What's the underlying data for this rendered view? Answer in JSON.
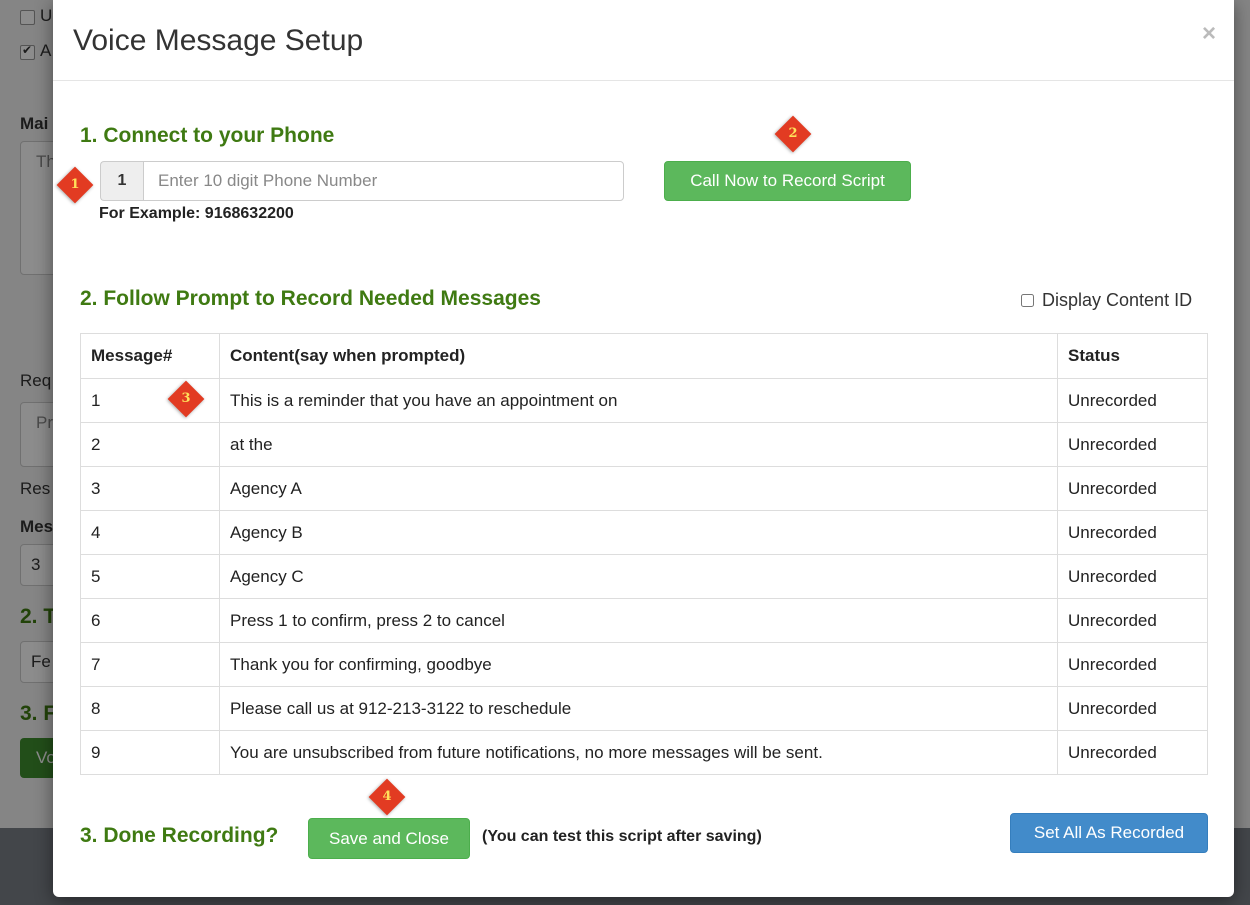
{
  "background": {
    "check1_label": "U",
    "check2_label": "A",
    "label_main": "Mai",
    "label_main_box": "Th",
    "label_req": "Req",
    "label_req_box": "Pr",
    "label_res": "Res",
    "label_mes": "Mes",
    "label_mes_value": "3",
    "section2": "2. T",
    "select_value": "Fe",
    "section3": "3. F",
    "button_label": "Vo"
  },
  "modal": {
    "title": "Voice Message Setup",
    "close_glyph": "×"
  },
  "markers": [
    "1",
    "2",
    "3",
    "4"
  ],
  "step1": {
    "title": "1. Connect to your Phone",
    "country_code": "1",
    "phone_placeholder": "Enter 10 digit Phone Number",
    "phone_value": "",
    "example": "For Example: 9168632200",
    "call_button": "Call Now to Record Script"
  },
  "step2": {
    "title": "2. Follow Prompt to Record Needed Messages",
    "display_content_id_label": "Display Content ID",
    "display_content_id_checked": false,
    "columns": [
      "Message#",
      "Content(say when prompted)",
      "Status"
    ],
    "rows": [
      {
        "num": "1",
        "content": "This is a reminder that you have an appointment on",
        "status": "Unrecorded"
      },
      {
        "num": "2",
        "content": "at the",
        "status": "Unrecorded"
      },
      {
        "num": "3",
        "content": "Agency A",
        "status": "Unrecorded"
      },
      {
        "num": "4",
        "content": "Agency B",
        "status": "Unrecorded"
      },
      {
        "num": "5",
        "content": "Agency C",
        "status": "Unrecorded"
      },
      {
        "num": "6",
        "content": "Press 1 to confirm, press 2 to cancel",
        "status": "Unrecorded"
      },
      {
        "num": "7",
        "content": "Thank you for confirming, goodbye",
        "status": "Unrecorded"
      },
      {
        "num": "8",
        "content": "Please call us at 912-213-3122 to reschedule",
        "status": "Unrecorded"
      },
      {
        "num": "9",
        "content": "You are unsubscribed from future notifications, no more messages will be sent.",
        "status": "Unrecorded"
      }
    ]
  },
  "step3": {
    "title": "3. Done Recording?",
    "save_button": "Save and Close",
    "note": "(You can test this script after saving)",
    "set_all_button": "Set All As Recorded"
  },
  "colors": {
    "section_green": "#3f7a12",
    "button_green": "#5cb85c",
    "button_blue": "#428bca",
    "marker_red": "#e23b22"
  }
}
